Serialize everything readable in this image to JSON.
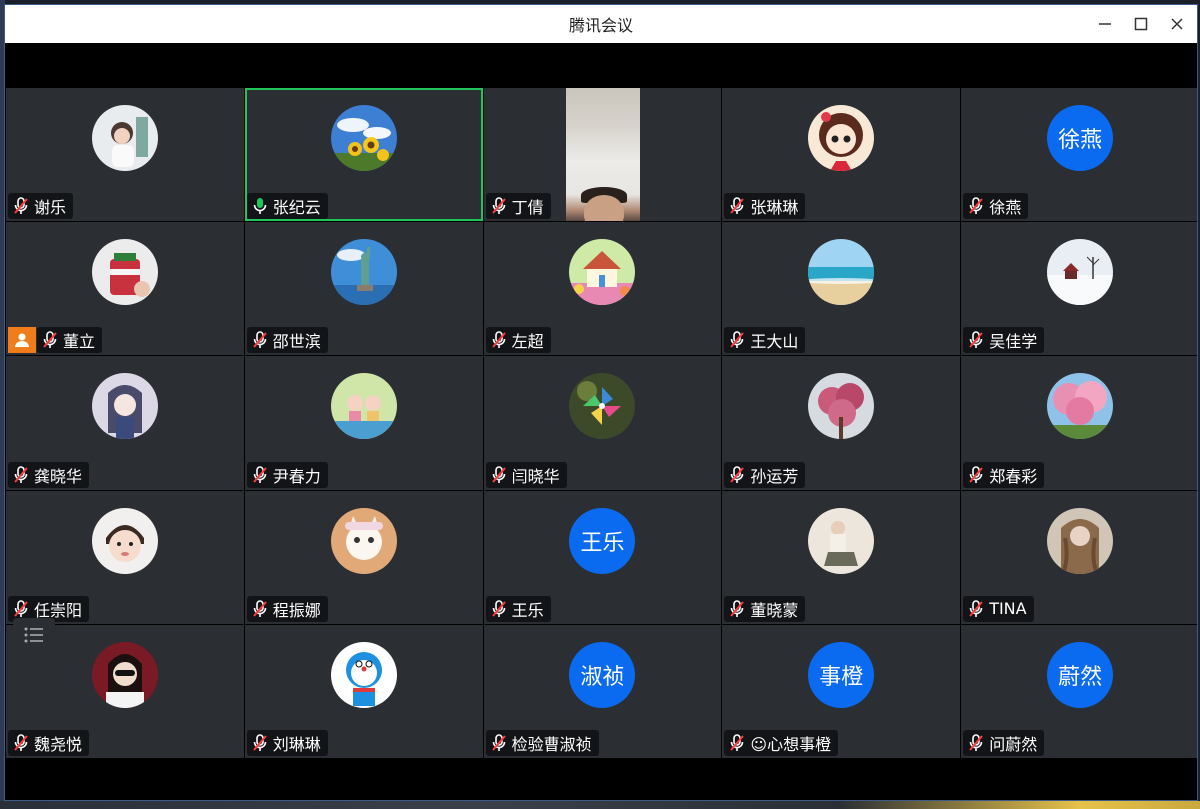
{
  "window": {
    "title": "腾讯会议"
  },
  "colors": {
    "accent_blue": "#0b6bf0",
    "active_green": "#1fc65b",
    "host_orange": "#f07d1c",
    "tile_bg": "#2b2e33"
  },
  "participants": [
    {
      "name": "谢乐",
      "avatar": "photo-girl-icon",
      "mic": "muted"
    },
    {
      "name": "张纪云",
      "avatar": "sunflower-icon",
      "mic": "speaking",
      "active": true
    },
    {
      "name": "丁倩",
      "avatar": "video",
      "mic": "muted"
    },
    {
      "name": "张琳琳",
      "avatar": "cartoon-girl-icon",
      "mic": "muted"
    },
    {
      "name": "徐燕",
      "avatar_text": "徐燕",
      "mic": "muted"
    },
    {
      "name": "董立",
      "avatar": "gift-jar-icon",
      "mic": "muted",
      "host": true
    },
    {
      "name": "邵世滨",
      "avatar": "statue-of-liberty-icon",
      "mic": "muted"
    },
    {
      "name": "左超",
      "avatar": "cottage-icon",
      "mic": "muted"
    },
    {
      "name": "王大山",
      "avatar": "beach-icon",
      "mic": "muted"
    },
    {
      "name": "吴佳学",
      "avatar": "snow-scene-icon",
      "mic": "muted"
    },
    {
      "name": "龚晓华",
      "avatar": "anime-girl-icon",
      "mic": "muted"
    },
    {
      "name": "尹春力",
      "avatar": "cartoon-kids-icon",
      "mic": "muted"
    },
    {
      "name": "闫晓华",
      "avatar": "pinwheel-icon",
      "mic": "muted"
    },
    {
      "name": "孙运芳",
      "avatar": "blossom-tree-icon",
      "mic": "muted"
    },
    {
      "name": "郑春彩",
      "avatar": "pink-tree-icon",
      "mic": "muted"
    },
    {
      "name": "任崇阳",
      "avatar": "baby-photo-icon",
      "mic": "muted"
    },
    {
      "name": "程振娜",
      "avatar": "kitten-icon",
      "mic": "muted"
    },
    {
      "name": "王乐",
      "avatar_text": "王乐",
      "mic": "muted"
    },
    {
      "name": "董晓蒙",
      "avatar": "sitting-girl-icon",
      "mic": "muted"
    },
    {
      "name": "TINA",
      "avatar": "long-hair-icon",
      "mic": "muted"
    },
    {
      "name": "魏尧悦",
      "avatar": "stylish-girl-icon",
      "mic": "muted"
    },
    {
      "name": "刘琳琳",
      "avatar": "doraemon-icon",
      "mic": "muted"
    },
    {
      "name": "检验曹淑祯",
      "avatar_text": "淑祯",
      "mic": "muted"
    },
    {
      "name": "☺心想事橙",
      "avatar_text": "事橙",
      "mic": "muted"
    },
    {
      "name": "问蔚然",
      "avatar_text": "蔚然",
      "mic": "muted"
    }
  ]
}
